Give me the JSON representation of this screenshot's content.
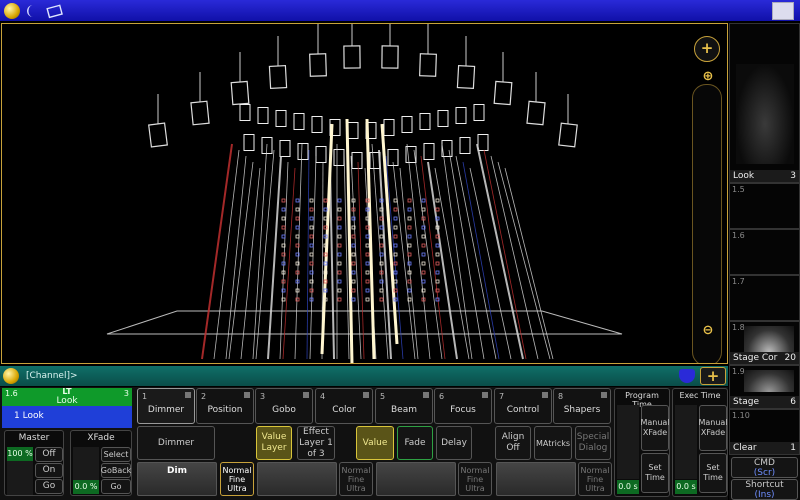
{
  "colors": {
    "accent": "#e8c04a",
    "titlebar": "#1a1ad0",
    "cmdline": "#0b5a55",
    "active_green": "#2ea043",
    "selected_blue": "#1f3fd8"
  },
  "titlebar": {
    "icons": [
      "globe-icon",
      "moon-icon",
      "window-icon"
    ]
  },
  "view3d": {
    "icons": {
      "zoom_add": "+",
      "zoom_in": "⊕",
      "zoom_out": "⊖"
    }
  },
  "right_column": {
    "top_label": "Look",
    "top_number": "3",
    "rows": [
      {
        "num": "1.5"
      },
      {
        "num": "1.6"
      },
      {
        "num": "1.7"
      },
      {
        "num": "1.8",
        "label": "Stage Cor",
        "value": "20"
      },
      {
        "num": "1.9",
        "label": "Stage",
        "value": "6"
      },
      {
        "num": "1.10",
        "label": "Clear",
        "value": "1"
      }
    ],
    "cmd": {
      "label": "CMD",
      "sub": "(Scr)"
    },
    "shortcut": {
      "label": "Shortcut",
      "sub": "(Ins)"
    }
  },
  "cmdline": {
    "prompt": "[Channel]>"
  },
  "exec": {
    "number": "1.6",
    "number_right": "3",
    "name_top": "LT",
    "name": "Look",
    "cue": "1 Look"
  },
  "master": {
    "title": "Master",
    "value": "100 %",
    "btns": [
      "Off",
      "On",
      "Go"
    ]
  },
  "xfade": {
    "title": "XFade",
    "value": "0.0 %",
    "btns": [
      "Select",
      "GoBack",
      "Go"
    ]
  },
  "feature_tabs": [
    {
      "num": "1",
      "label": "Dimmer"
    },
    {
      "num": "2",
      "label": "Position"
    },
    {
      "num": "3",
      "label": "Gobo"
    },
    {
      "num": "4",
      "label": "Color"
    },
    {
      "num": "5",
      "label": "Beam"
    },
    {
      "num": "6",
      "label": "Focus"
    },
    {
      "num": "7",
      "label": "Control"
    },
    {
      "num": "8",
      "label": "Shapers"
    }
  ],
  "mid_buttons": {
    "dimmer": "Dimmer",
    "value_layer": "Value Layer",
    "effect_layer": "Effect Layer 1 of 3",
    "value": "Value",
    "fade": "Fade",
    "delay": "Delay",
    "align": "Align Off",
    "matricks": "MAtricks",
    "special": "Special Dialog"
  },
  "encoders": {
    "dim": "Dim",
    "res": [
      "Normal",
      "Fine",
      "Ultra"
    ]
  },
  "program_time": {
    "title": "Program Time",
    "manual": "Manual XFade",
    "set": "Set Time",
    "value": "0.0 s"
  },
  "exec_time": {
    "title": "Exec Time",
    "manual": "Manual XFade",
    "set": "Set Time",
    "value": "0.0 s"
  }
}
